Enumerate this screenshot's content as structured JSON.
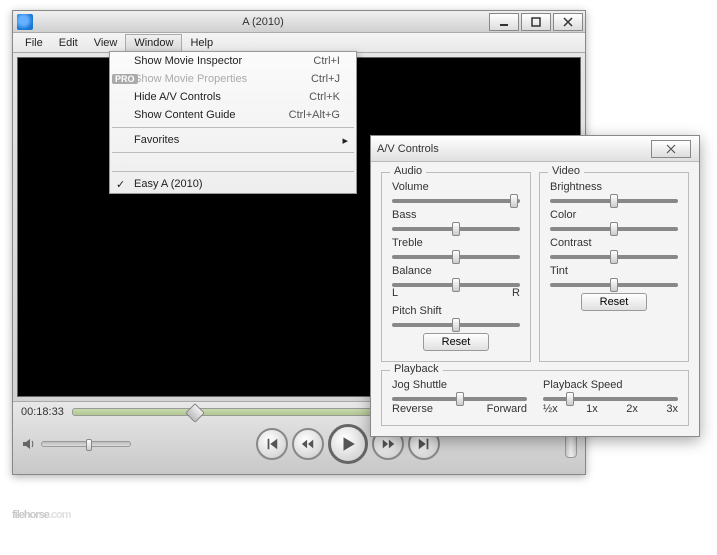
{
  "player": {
    "title": "A (2010)",
    "menus": {
      "file": "File",
      "edit": "Edit",
      "view": "View",
      "window": "Window",
      "help": "Help"
    },
    "time": "00:18:33"
  },
  "window_menu": {
    "show_inspector": {
      "label": "Show Movie Inspector",
      "shortcut": "Ctrl+I"
    },
    "show_properties": {
      "label": "Show Movie Properties",
      "shortcut": "Ctrl+J",
      "pro": "PRO"
    },
    "hide_av": {
      "label": "Hide A/V Controls",
      "shortcut": "Ctrl+K"
    },
    "show_guide": {
      "label": "Show Content Guide",
      "shortcut": "Ctrl+Alt+G"
    },
    "favorites": {
      "label": "Favorites"
    },
    "easy": {
      "label": "Easy A (2010)"
    }
  },
  "av": {
    "title": "A/V Controls",
    "audio_legend": "Audio",
    "video_legend": "Video",
    "playback_legend": "Playback",
    "volume": "Volume",
    "bass": "Bass",
    "treble": "Treble",
    "balance": "Balance",
    "balance_l": "L",
    "balance_r": "R",
    "pitch": "Pitch Shift",
    "brightness": "Brightness",
    "color": "Color",
    "contrast": "Contrast",
    "tint": "Tint",
    "reset": "Reset",
    "jog": "Jog Shuttle",
    "jog_rev": "Reverse",
    "jog_fwd": "Forward",
    "speed": "Playback Speed",
    "s_half": "½x",
    "s_1": "1x",
    "s_2": "2x",
    "s_3": "3x"
  },
  "watermark": {
    "a": "filehorse",
    "b": ".com"
  }
}
